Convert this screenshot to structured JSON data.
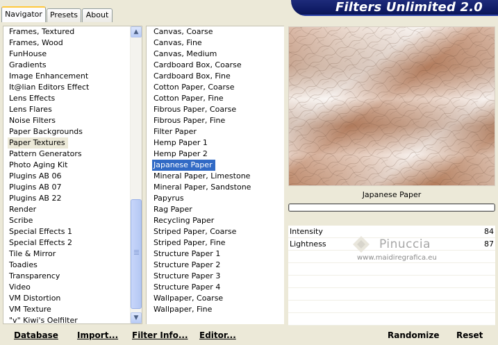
{
  "tabs": [
    {
      "label": "Navigator",
      "active": true
    },
    {
      "label": "Presets",
      "active": false
    },
    {
      "label": "About",
      "active": false
    }
  ],
  "app": {
    "title": "Filters Unlimited 2.0"
  },
  "categories": {
    "items": [
      "Frames, Textured",
      "Frames, Wood",
      "FunHouse",
      "Gradients",
      "Image Enhancement",
      "It@lian Editors Effect",
      "Lens Effects",
      "Lens Flares",
      "Noise Filters",
      "Paper Backgrounds",
      "Paper Textures",
      "Pattern Generators",
      "Photo Aging Kit",
      "Plugins AB 06",
      "Plugins AB 07",
      "Plugins AB 22",
      "Render",
      "Scribe",
      "Special Effects 1",
      "Special Effects 2",
      "Tile & Mirror",
      "Toadies",
      "Transparency",
      "Video",
      "VM Distortion",
      "VM Texture",
      "\"v\" Kiwi's Oelfilter"
    ],
    "selected": "Paper Textures"
  },
  "filters": {
    "items": [
      "Canvas, Coarse",
      "Canvas, Fine",
      "Canvas, Medium",
      "Cardboard Box, Coarse",
      "Cardboard Box, Fine",
      "Cotton Paper, Coarse",
      "Cotton Paper, Fine",
      "Fibrous Paper, Coarse",
      "Fibrous Paper, Fine",
      "Filter Paper",
      "Hemp Paper 1",
      "Hemp Paper 2",
      "Japanese Paper",
      "Mineral Paper, Limestone",
      "Mineral Paper, Sandstone",
      "Papyrus",
      "Rag Paper",
      "Recycling Paper",
      "Striped Paper, Coarse",
      "Striped Paper, Fine",
      "Structure Paper 1",
      "Structure Paper 2",
      "Structure Paper 3",
      "Structure Paper 4",
      "Wallpaper, Coarse",
      "Wallpaper, Fine"
    ],
    "selected": "Japanese Paper"
  },
  "preview": {
    "filter_name": "Japanese Paper",
    "progress": 0
  },
  "sliders": [
    {
      "label": "Intensity",
      "value": "84"
    },
    {
      "label": "Lightness",
      "value": "87"
    }
  ],
  "watermark": {
    "title": "Pinuccia",
    "subtitle": "www.maidiregrafica.eu"
  },
  "toolbar": {
    "database": "Database",
    "import": "Import...",
    "filter_info": "Filter Info...",
    "editor": "Editor...",
    "randomize": "Randomize",
    "reset": "Reset"
  },
  "colors": {
    "selection": "#316ac5",
    "banner": "#101c66",
    "texture_light": "#f2ece8",
    "texture_dark": "#b27a58"
  }
}
